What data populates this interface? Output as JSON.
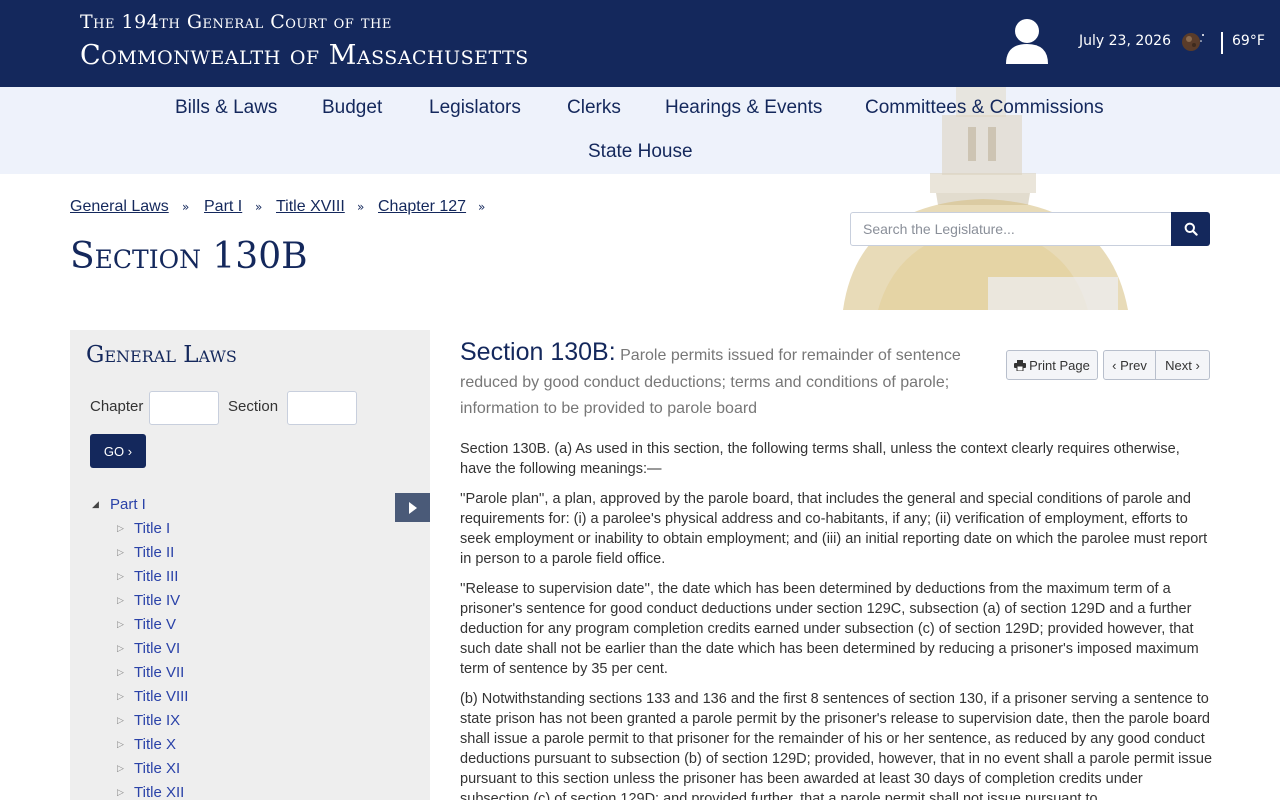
{
  "header": {
    "court_line1": "The 194th General Court of the",
    "court_line2": "Commonwealth of Massachusetts",
    "date": "July 23, 2026",
    "temperature": "69°F",
    "user_icon": "user-icon",
    "weather_icon": "moon-icon"
  },
  "nav": {
    "items": [
      "Bills & Laws",
      "Budget",
      "Legislators",
      "Clerks",
      "Hearings & Events",
      "Committees & Commissions",
      "State House"
    ]
  },
  "breadcrumb": {
    "items": [
      "General Laws",
      "Part I",
      "Title XVIII",
      "Chapter 127"
    ],
    "separator": "»"
  },
  "page_title": "Section 130B",
  "search": {
    "placeholder": "Search the Legislature...",
    "icon": "search-icon"
  },
  "sidebar": {
    "title": "General Laws",
    "chapter_label": "Chapter",
    "section_label": "Section",
    "go_label": "GO ›",
    "toggle_icon": "caret-right-icon",
    "tree": {
      "root": "Part I",
      "children": [
        "Title I",
        "Title II",
        "Title III",
        "Title IV",
        "Title V",
        "Title VI",
        "Title VII",
        "Title VIII",
        "Title IX",
        "Title X",
        "Title XI",
        "Title XII"
      ]
    }
  },
  "content": {
    "section_label": "Section 130B:",
    "section_summary": "Parole permits issued for remainder of sentence reduced by good conduct deductions; terms and conditions of parole; information to be provided to parole board",
    "print_label": "Print Page",
    "print_icon": "print-icon",
    "prev_label": "‹ Prev",
    "next_label": "Next ›",
    "paragraphs": [
      "Section 130B. (a) As used in this section, the following terms shall, unless the context clearly requires otherwise, have the following meanings:—",
      "''Parole plan'', a plan, approved by the parole board, that includes the general and special conditions of parole and requirements for: (i) a parolee's physical address and co-habitants, if any; (ii) verification of employment, efforts to seek employment or inability to obtain employment; and (iii) an initial reporting date on which the parolee must report in person to a parole field office.",
      "''Release to supervision date'', the date which has been determined by deductions from the maximum term of a prisoner's sentence for good conduct deductions under section 129C, subsection (a) of section 129D and a further deduction for any program completion credits earned under subsection (c) of section 129D; provided however, that such date shall not be earlier than the date which has been determined by reducing a prisoner's imposed maximum term of sentence by 35 per cent.",
      "(b) Notwithstanding sections 133 and 136 and the first 8 sentences of section 130, if a prisoner serving a sentence to state prison has not been granted a parole permit by the prisoner's release to supervision date, then the parole board shall issue a parole permit to that prisoner for the remainder of his or her sentence, as reduced by any good conduct deductions pursuant to subsection (b) of section 129D; provided, however, that in no event shall a parole permit issue pursuant to this section unless the prisoner has been awarded at least 30 days of completion credits under subsection (c) of section 129D; and provided further, that a parole permit shall not issue pursuant to"
    ]
  }
}
